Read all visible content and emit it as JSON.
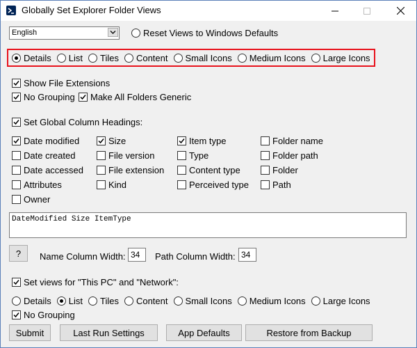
{
  "window": {
    "title": "Globally Set Explorer Folder Views",
    "controls": {
      "minimize": "minimize-icon",
      "maximize": "maximize-icon",
      "close": "close-icon"
    }
  },
  "language": {
    "selected": "English"
  },
  "reset": {
    "label": "Reset Views to Windows Defaults",
    "checked": false
  },
  "view_modes": {
    "selected": "Details",
    "options": [
      "Details",
      "List",
      "Tiles",
      "Content",
      "Small Icons",
      "Medium Icons",
      "Large Icons"
    ]
  },
  "options": {
    "show_ext": {
      "label": "Show File Extensions",
      "checked": true
    },
    "no_grouping": {
      "label": "No Grouping",
      "checked": true
    },
    "generic": {
      "label": "Make All Folders Generic",
      "checked": true
    },
    "global_cols": {
      "label": "Set Global Column Headings:",
      "checked": true
    }
  },
  "columns": {
    "col1": [
      {
        "label": "Date modified",
        "checked": true
      },
      {
        "label": "Date created",
        "checked": false
      },
      {
        "label": "Date accessed",
        "checked": false
      },
      {
        "label": "Attributes",
        "checked": false
      },
      {
        "label": "Owner",
        "checked": false
      }
    ],
    "col2": [
      {
        "label": "Size",
        "checked": true
      },
      {
        "label": "File version",
        "checked": false
      },
      {
        "label": "File extension",
        "checked": false
      },
      {
        "label": "Kind",
        "checked": false
      }
    ],
    "col3": [
      {
        "label": "Item type",
        "checked": true
      },
      {
        "label": "Type",
        "checked": false
      },
      {
        "label": "Content type",
        "checked": false
      },
      {
        "label": "Perceived type",
        "checked": false
      }
    ],
    "col4": [
      {
        "label": "Folder name",
        "checked": false
      },
      {
        "label": "Folder path",
        "checked": false
      },
      {
        "label": "Folder",
        "checked": false
      },
      {
        "label": "Path",
        "checked": false
      }
    ]
  },
  "columns_text": "DateModified Size ItemType",
  "help_label": "?",
  "widths": {
    "name_label": "Name Column Width:",
    "name_value": "34",
    "path_label": "Path Column Width:",
    "path_value": "34"
  },
  "thispc": {
    "label": "Set views for \"This PC\" and \"Network\":",
    "checked": true
  },
  "view_modes2": {
    "selected": "List",
    "options": [
      "Details",
      "List",
      "Tiles",
      "Content",
      "Small Icons",
      "Medium Icons",
      "Large Icons"
    ]
  },
  "no_grouping2": {
    "label": "No Grouping",
    "checked": true
  },
  "buttons": {
    "submit": "Submit",
    "last_run": "Last Run Settings",
    "app_defaults": "App Defaults",
    "restore": "Restore from Backup"
  },
  "colors": {
    "highlight": "#e8121c",
    "title_icon": "#012456"
  }
}
